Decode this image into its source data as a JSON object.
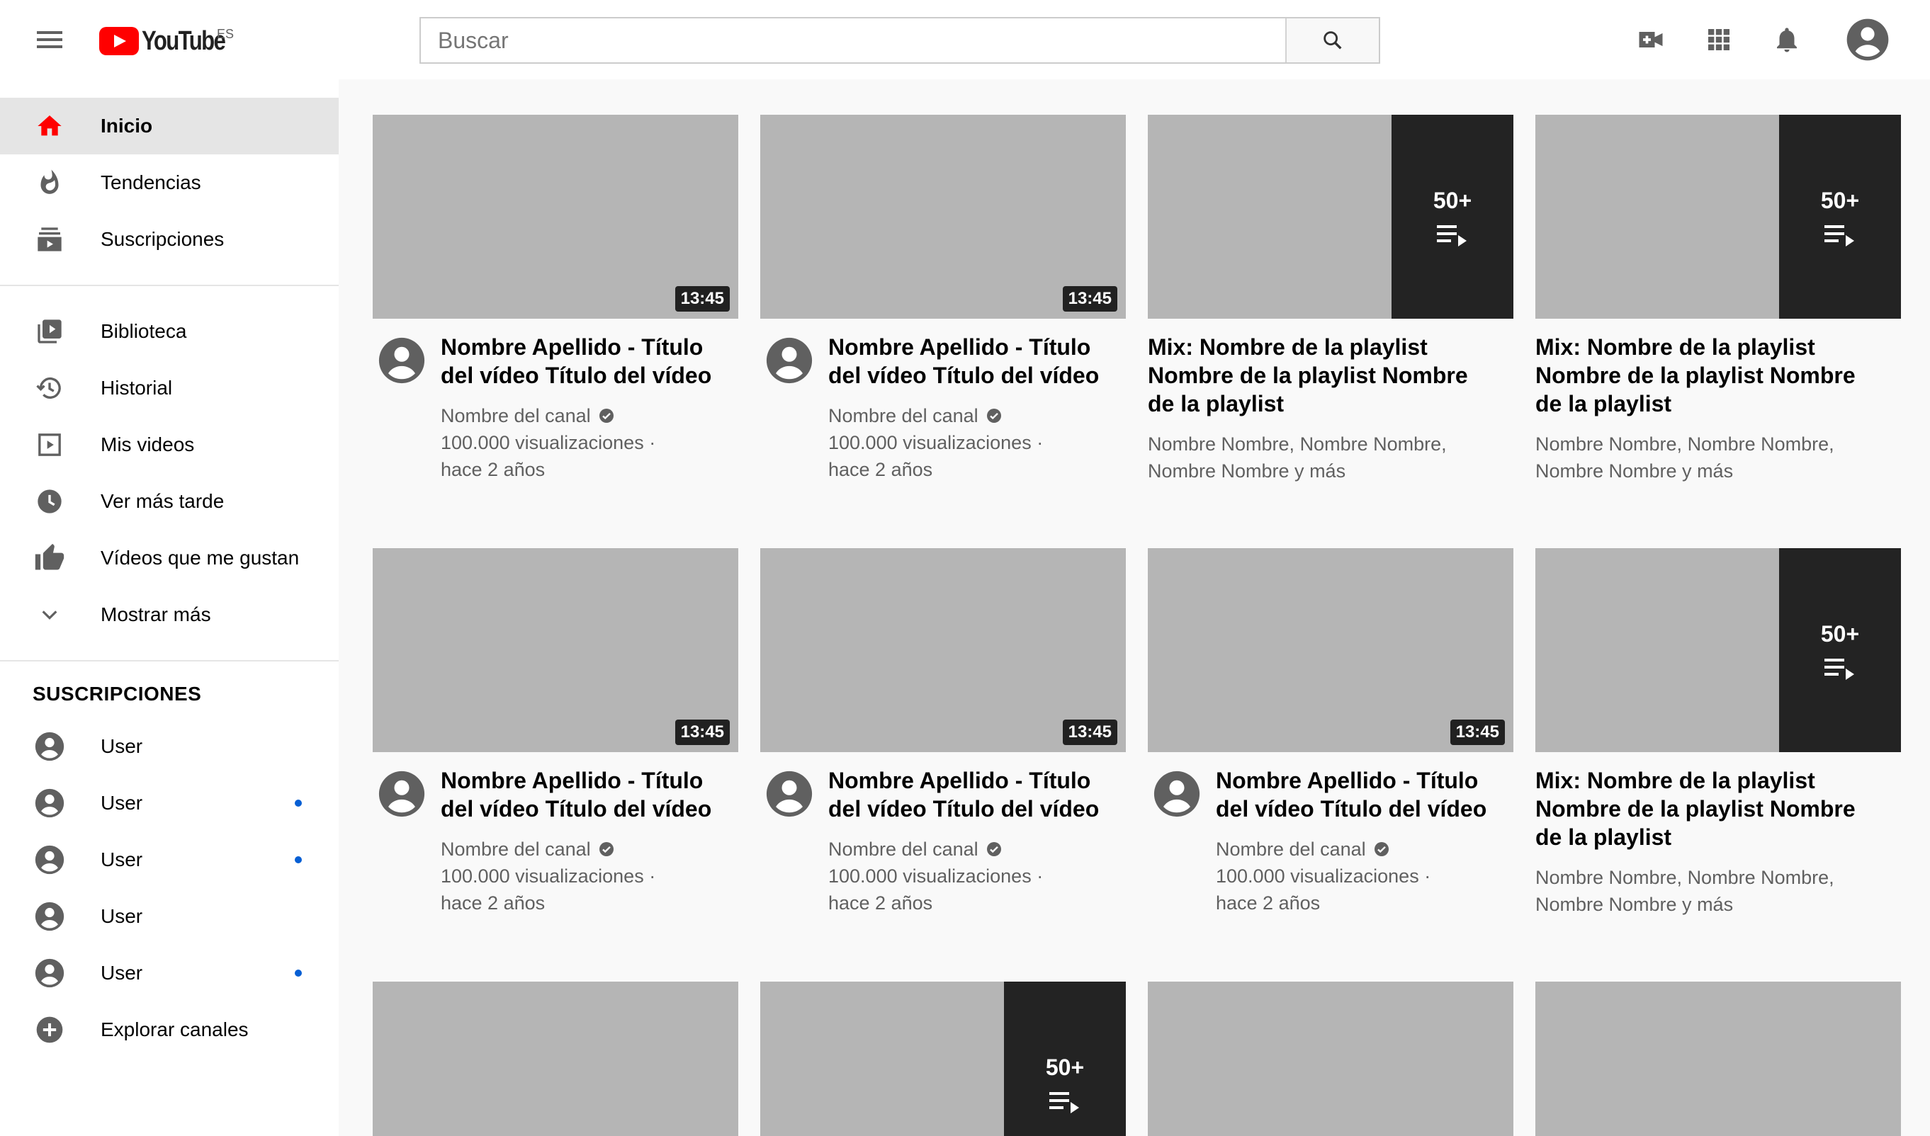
{
  "header": {
    "logo_text": "YouTube",
    "region": "ES",
    "search_placeholder": "Buscar"
  },
  "sidebar": {
    "main": [
      {
        "label": "Inicio",
        "icon": "home-icon",
        "active": true
      },
      {
        "label": "Tendencias",
        "icon": "trending-icon"
      },
      {
        "label": "Suscripciones",
        "icon": "subscriptions-icon"
      }
    ],
    "library": [
      {
        "label": "Biblioteca",
        "icon": "library-icon"
      },
      {
        "label": "Historial",
        "icon": "history-icon"
      },
      {
        "label": "Mis videos",
        "icon": "my-videos-icon"
      },
      {
        "label": "Ver más tarde",
        "icon": "watch-later-icon"
      },
      {
        "label": "Vídeos que me gustan",
        "icon": "thumbs-up-icon"
      },
      {
        "label": "Mostrar más",
        "icon": "chevron-down-icon"
      }
    ],
    "subscriptions_title": "SUSCRIPCIONES",
    "subscriptions": [
      {
        "label": "User",
        "new_content": false
      },
      {
        "label": "User",
        "new_content": true
      },
      {
        "label": "User",
        "new_content": true
      },
      {
        "label": "User",
        "new_content": false
      },
      {
        "label": "User",
        "new_content": true
      }
    ],
    "explore_label": "Explorar canales"
  },
  "videos": [
    {
      "type": "video",
      "title_line1": "Nombre Apellido - Título",
      "title_line2": "del vídeo Título del vídeo",
      "channel": "Nombre del canal",
      "views": "100.000 visualizaciones ·",
      "age": "hace 2 años",
      "duration": "13:45"
    },
    {
      "type": "video",
      "title_line1": "Nombre Apellido - Título",
      "title_line2": "del vídeo Título del vídeo",
      "channel": "Nombre del canal",
      "views": "100.000 visualizaciones ·",
      "age": "hace 2 años",
      "duration": "13:45"
    },
    {
      "type": "playlist",
      "title_line1": "Mix: Nombre de la playlist",
      "title_line2": "Nombre de la playlist Nombre",
      "title_line3": "de la playlist",
      "names_line1": "Nombre Nombre, Nombre Nombre,",
      "names_line2": "Nombre Nombre y más",
      "count": "50+"
    },
    {
      "type": "playlist",
      "title_line1": "Mix: Nombre de la playlist",
      "title_line2": "Nombre de la playlist Nombre",
      "title_line3": "de la playlist",
      "names_line1": "Nombre Nombre, Nombre Nombre,",
      "names_line2": "Nombre Nombre y más",
      "count": "50+"
    },
    {
      "type": "video",
      "title_line1": "Nombre Apellido - Título",
      "title_line2": "del vídeo Título del vídeo",
      "channel": "Nombre del canal",
      "views": "100.000 visualizaciones ·",
      "age": "hace 2 años",
      "duration": "13:45"
    },
    {
      "type": "video",
      "title_line1": "Nombre Apellido - Título",
      "title_line2": "del vídeo Título del vídeo",
      "channel": "Nombre del canal",
      "views": "100.000 visualizaciones ·",
      "age": "hace 2 años",
      "duration": "13:45"
    },
    {
      "type": "video",
      "title_line1": "Nombre Apellido - Título",
      "title_line2": "del vídeo Título del vídeo",
      "channel": "Nombre del canal",
      "views": "100.000 visualizaciones ·",
      "age": "hace 2 años",
      "duration": "13:45"
    },
    {
      "type": "playlist",
      "title_line1": "Mix: Nombre de la playlist",
      "title_line2": "Nombre de la playlist Nombre",
      "title_line3": "de la playlist",
      "names_line1": "Nombre Nombre, Nombre Nombre,",
      "names_line2": "Nombre Nombre y más",
      "count": "50+"
    },
    {
      "type": "thumb-only"
    },
    {
      "type": "playlist-thumb-only",
      "count": "50+"
    },
    {
      "type": "thumb-only"
    },
    {
      "type": "thumb-only"
    }
  ],
  "colors": {
    "brand_red": "#ff0000",
    "thumb_placeholder": "#b5b5b5",
    "playlist_overlay": "#232323",
    "new_dot": "#065fd4"
  }
}
